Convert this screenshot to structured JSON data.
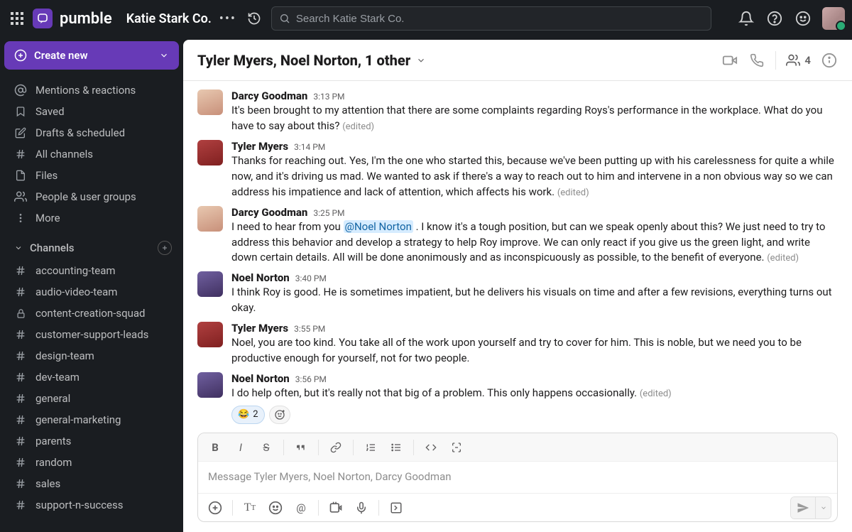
{
  "brand": "pumble",
  "workspace": "Katie Stark Co.",
  "search": {
    "placeholder": "Search Katie Stark Co."
  },
  "create_label": "Create new",
  "nav": [
    {
      "id": "mentions",
      "label": "Mentions & reactions"
    },
    {
      "id": "saved",
      "label": "Saved"
    },
    {
      "id": "drafts",
      "label": "Drafts & scheduled"
    },
    {
      "id": "all-chan",
      "label": "All channels"
    },
    {
      "id": "files",
      "label": "Files"
    },
    {
      "id": "people",
      "label": "People & user groups"
    },
    {
      "id": "more",
      "label": "More"
    }
  ],
  "channels_header": "Channels",
  "channels": [
    {
      "name": "accounting-team",
      "private": false
    },
    {
      "name": "audio-video-team",
      "private": false
    },
    {
      "name": "content-creation-squad",
      "private": true
    },
    {
      "name": "customer-support-leads",
      "private": false
    },
    {
      "name": "design-team",
      "private": false
    },
    {
      "name": "dev-team",
      "private": false
    },
    {
      "name": "general",
      "private": false
    },
    {
      "name": "general-marketing",
      "private": false
    },
    {
      "name": "parents",
      "private": false
    },
    {
      "name": "random",
      "private": false
    },
    {
      "name": "sales",
      "private": false
    },
    {
      "name": "support-n-success",
      "private": false
    }
  ],
  "chat": {
    "title": "Tyler Myers, Noel Norton, 1 other",
    "member_count": "4"
  },
  "messages": [
    {
      "author": "Darcy Goodman",
      "avatar": "darcy",
      "time": "3:13 PM",
      "text": "It's been brought to my attention that there are some complaints regarding Roys's performance in the workplace. What do you have to say about this?",
      "edited": true
    },
    {
      "author": "Tyler Myers",
      "avatar": "tyler",
      "time": "3:14 PM",
      "text": "Thanks for reaching out. Yes, I'm the one who started this, because we've been putting up with his carelessness for quite a while now, and it's driving us mad. We wanted to ask if there's a way to reach out to him and intervene in a non obvious way so we can address his impatience and lack of attention, which affects his work.",
      "edited": true
    },
    {
      "author": "Darcy Goodman",
      "avatar": "darcy",
      "time": "3:25 PM",
      "text_pre": "I need to hear from you ",
      "mention": "@Noel Norton",
      "text_post": " . I know it's a tough position, but can we speak openly about this? We just need to try to address this behavior and develop a strategy to help Roy improve. We can only react if you give us the green light, and write down certain details. All will be done anonimously and as inconspicuously as possible, to the benefit of everyone.",
      "edited": true
    },
    {
      "author": "Noel Norton",
      "avatar": "noel",
      "time": "3:40 PM",
      "text": "I think Roy is good. He is sometimes impatient, but he delivers his visuals on time and after a few revisions, everything turns out okay.",
      "edited": false
    },
    {
      "author": "Tyler Myers",
      "avatar": "tyler",
      "time": "3:55 PM",
      "text": "Noel, you are too kind. You take all of the work upon yourself and try to cover for him. This is noble, but we need you to be productive enough for yourself, not for two people.",
      "edited": false
    },
    {
      "author": "Noel Norton",
      "avatar": "noel",
      "time": "3:56 PM",
      "text": "I do help often, but it's really not that big of a problem. This only happens occasionally.",
      "edited": true,
      "reactions": [
        {
          "emoji": "😂",
          "count": "2"
        }
      ]
    }
  ],
  "edited_label": "(edited)",
  "composer": {
    "placeholder": "Message Tyler Myers, Noel Norton, Darcy Goodman"
  }
}
